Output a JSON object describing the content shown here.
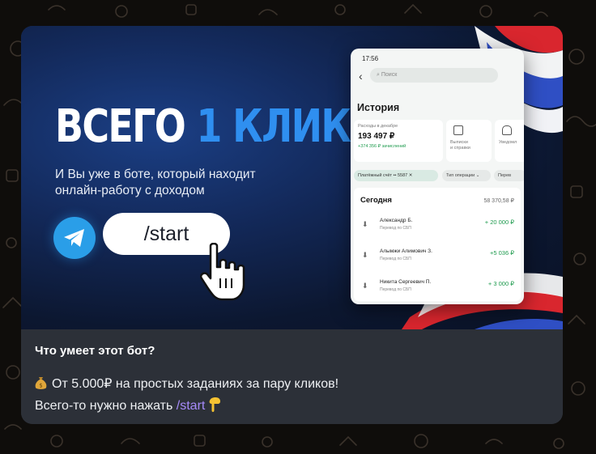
{
  "banner": {
    "headline_part1": "ВСЕГО",
    "headline_part2": "1 КЛИК",
    "subheadline_line1": "И Вы уже в боте, который находит",
    "subheadline_line2": "онлайн-работу с доходом",
    "start_button_label": "/start",
    "phone": {
      "time": "17:56",
      "search_placeholder": "Поиск",
      "history_title": "История",
      "expenses_label": "Расходы в декабре",
      "expenses_amount": "193 497 ₽",
      "credited_label": "+374 356 ₽ зачислений",
      "statements_label_line1": "Выписки",
      "statements_label_line2": "и справки",
      "notifications_label": "Уведомл",
      "filter_chips": [
        "Платёжный счёт •• 5587 ✕",
        "Тип операции ⌄",
        "Перев"
      ],
      "today_label": "Сегодня",
      "today_total": "58 370,58 ₽",
      "transactions": [
        {
          "name": "Александр Б.",
          "type": "Перевод по СБП",
          "amount": "+ 20 000 ₽"
        },
        {
          "name": "Алымжи Алимович З.",
          "type": "Перевод по СБП",
          "amount": "+5 036 ₽"
        },
        {
          "name": "Никита Сергеевич П.",
          "type": "Перевод по СБП",
          "amount": "+ 3 000 ₽"
        }
      ]
    }
  },
  "caption": {
    "title": "Что умеет этот бот?",
    "line1": "От 5.000₽ на простых заданиях за пару кликов!",
    "line2_prefix": "Всего-то нужно нажать",
    "line2_command": "/start"
  },
  "colors": {
    "accent_blue": "#2f8ff0",
    "command_link": "#a78bfa",
    "income_green": "#1d9a4d",
    "telegram_blue": "#2a9ee8"
  },
  "icons": [
    "telegram-logo-icon",
    "pointing-hand-cursor-icon",
    "money-bag-emoji-icon",
    "pointing-down-emoji-icon",
    "back-arrow-icon",
    "search-icon",
    "document-icon",
    "bell-icon",
    "incoming-arrow-icon"
  ]
}
